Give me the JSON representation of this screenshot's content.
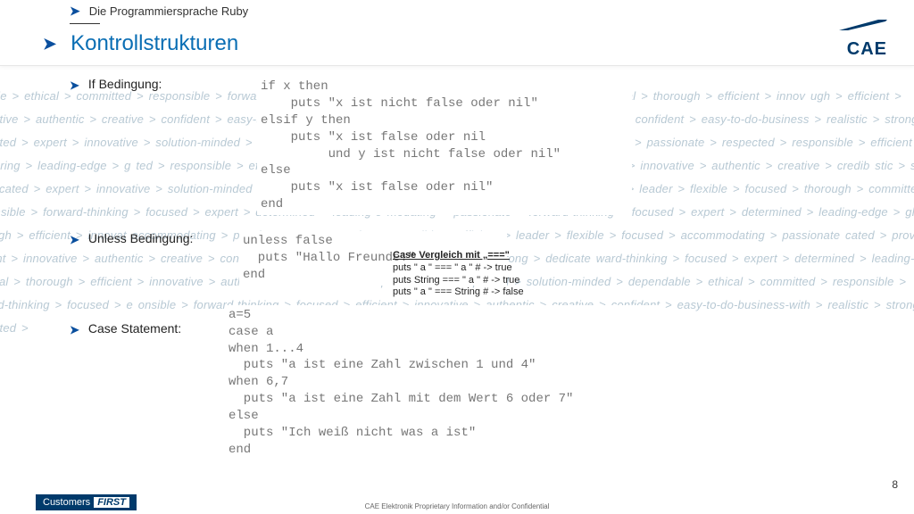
{
  "breadcrumb": "Die Programmiersprache Ruby",
  "title": "Kontrollstrukturen",
  "logo": "CAE",
  "bullets": {
    "if": "If Bedingung:",
    "unless": "Unless Bedingung:",
    "case": "Case Statement:"
  },
  "code": {
    "if": "if x then\n    puts \"x ist nicht false oder nil\"\nelsif y then\n    puts \"x ist false oder nil\n         und y ist nicht false oder nil\"\nelse\n    puts \"x ist false oder nil\"\nend",
    "unless": "unless false\n  puts \"Hallo Freunde!\"\nend",
    "case": "a=5\ncase a\nwhen 1...4\n  puts \"a ist eine Zahl zwischen 1 und 4\"\nwhen 6,7\n  puts \"a ist eine Zahl mit dem Wert 6 oder 7\"\nelse\n  puts \"Ich weiß nicht was a ist\"\nend"
  },
  "overlay": {
    "title": "Case Vergleich mit „===\"",
    "l1": "puts \" a \" === \" a \" # -> true",
    "l2": "puts String === \" a \" # -> true",
    "l3": "puts \" a \" === String # -> false"
  },
  "footer": {
    "customers": "Customers",
    "first": "FIRST",
    "confidential": "CAE Elektronik Proprietary Information and/or Confidential"
  },
  "page": "8",
  "bg": "endable > ethical > committed > responsible > forward-thinking > focused > expert > determined > leading-edge > global > thorough > efficient > innov\nugh > efficient > innovative > authentic > creative > confident > easy-to-do-business > flexible > experienced > reliable > accommodating\nconfident > easy-to-do-business > realistic > strong > dedicated > expert > innovative > solution-minded > dependable > experienc\n> experienced > reliable > accommodating > passionate > respected > responsible > efficient > pioneering > leading-edge > g\nted > responsible > efficient > pioneering > leading-edge > global > thorough > efficient > innovative > authentic > creative > credib\nstic > strong > dedicated > expert > innovative > solution-minded > dependable > ethical > committed > responsible > forward-think\n> leader > flexible > focused > thorough > committed > responsible > forward-thinking > focused > expert > determined > leading-e\nmodating > passionate > forward-thinking > focused > expert > determined > leading-edge > global > thorough > efficient > innovat\naccommodating > passionate > respected > responsible > efficient > leader > flexible > focused > accommodating > passionate\ncated > proven > efficient > innovative > authentic > creative > confident > easy-to-do-business-with > realistic > strong > dedicate\nward-thinking > focused > expert > determined > leading-edge > global > thorough > efficient > innovative > authentic > creative > c\nn > passionate > respected > solution-minded > dependable > ethical > committed > responsible > forward-thinking > focused > e\nonsible > forward-thinking > focused > efficient > innovative > authentic > creative > confident > easy-to-do-business-with > realistic > strong > dedicated >"
}
